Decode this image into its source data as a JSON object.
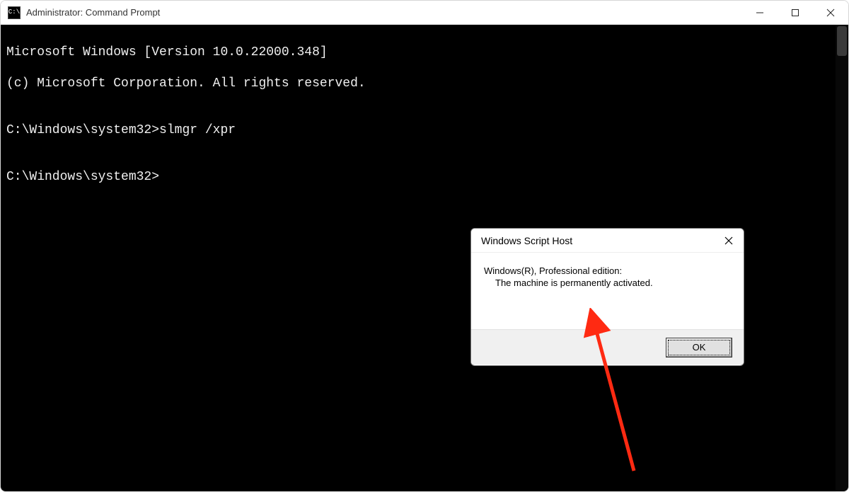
{
  "window": {
    "title": "Administrator: Command Prompt",
    "icon_label": "C:\\"
  },
  "console": {
    "line1": "Microsoft Windows [Version 10.0.22000.348]",
    "line2": "(c) Microsoft Corporation. All rights reserved.",
    "blank1": "",
    "line3_prompt": "C:\\Windows\\system32>",
    "line3_cmd": "slmgr /xpr",
    "blank2": "",
    "line4_prompt": "C:\\Windows\\system32>"
  },
  "dialog": {
    "title": "Windows Script Host",
    "message_line1": "Windows(R), Professional edition:",
    "message_line2": "The machine is permanently activated.",
    "ok_label": "OK"
  },
  "annotation": {
    "arrow_color": "#ff2a12"
  }
}
